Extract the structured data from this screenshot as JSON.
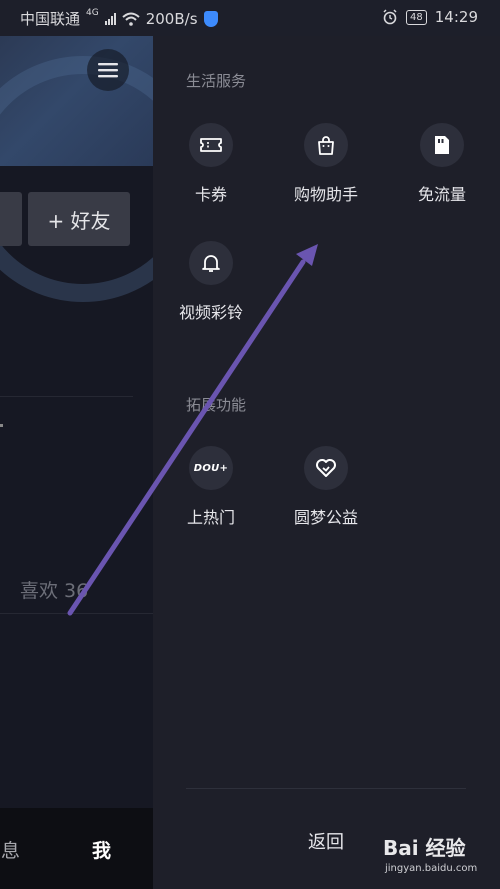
{
  "status_bar": {
    "carrier": "中国联通",
    "network": "4G",
    "speed": "200B/s",
    "battery": "48",
    "time": "14:29"
  },
  "left_page": {
    "add_friend_label": "+ 好友",
    "likes_text": "喜欢 36",
    "nav_messages": "消息",
    "nav_me": "我"
  },
  "drawer": {
    "section_life": "生活服务",
    "life_items": [
      {
        "label": "卡券",
        "icon": "ticket-icon"
      },
      {
        "label": "购物助手",
        "icon": "shopping-bag-icon"
      },
      {
        "label": "免流量",
        "icon": "sim-card-icon"
      },
      {
        "label": "视频彩铃",
        "icon": "bell-icon"
      }
    ],
    "section_ext": "拓展功能",
    "ext_items": [
      {
        "label": "上热门",
        "icon": "dou-plus-icon",
        "icon_text": "DOU+"
      },
      {
        "label": "圆梦公益",
        "icon": "heart-icon"
      }
    ],
    "back_label": "返回"
  },
  "watermark": {
    "brand": "Bai 经验",
    "url": "jingyan.baidu.com"
  },
  "colors": {
    "drawer_bg": "#1e1f29",
    "icon_circle": "#2d2f3b",
    "arrow": "#6a55b0"
  }
}
